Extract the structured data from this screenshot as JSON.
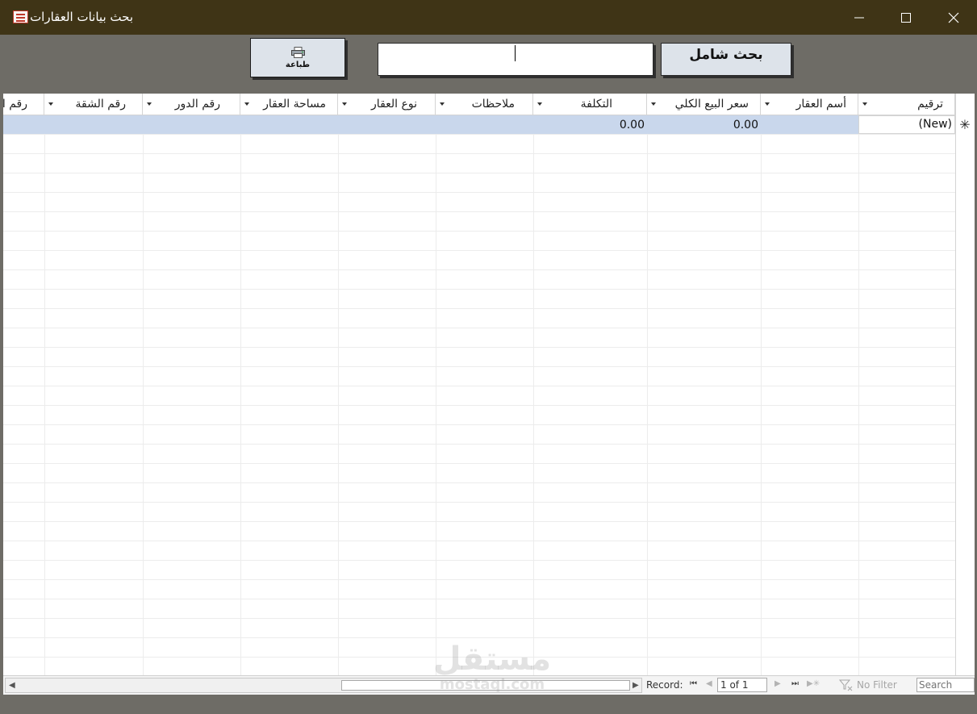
{
  "window": {
    "title": "بحث بيانات العقارات",
    "icon": "form-icon"
  },
  "controls": {
    "minimize": "minimize-icon",
    "maximize": "maximize-icon",
    "close": "close-icon"
  },
  "toolbar": {
    "print_label": "طباعة",
    "search_label": "بحث شامل",
    "search_value": ""
  },
  "columns": [
    {
      "key": "seq",
      "label": "ترقيم"
    },
    {
      "key": "name",
      "label": "أسم العقار"
    },
    {
      "key": "sale_price",
      "label": "سعر البيع الكلي"
    },
    {
      "key": "cost",
      "label": "التكلفة"
    },
    {
      "key": "notes",
      "label": "ملاحظات"
    },
    {
      "key": "type",
      "label": "نوع العقار"
    },
    {
      "key": "area",
      "label": "مساحة العقار"
    },
    {
      "key": "floor",
      "label": "رقم الدور"
    },
    {
      "key": "apartment",
      "label": "رقم الشقة"
    },
    {
      "key": "more",
      "label": "رقم ال"
    }
  ],
  "new_row": {
    "seq": "(New)",
    "sale_price": "0.00",
    "cost": "0.00"
  },
  "status": {
    "record_label": "Record:",
    "record_value": "1 of 1",
    "no_filter": "No Filter",
    "search_placeholder": "Search"
  },
  "watermark": {
    "arabic": "مستقل",
    "latin": "mostaql.com"
  },
  "colors": {
    "titlebar": "#3f3416",
    "background": "#6e6c66",
    "new_row": "#c9d7ec"
  }
}
